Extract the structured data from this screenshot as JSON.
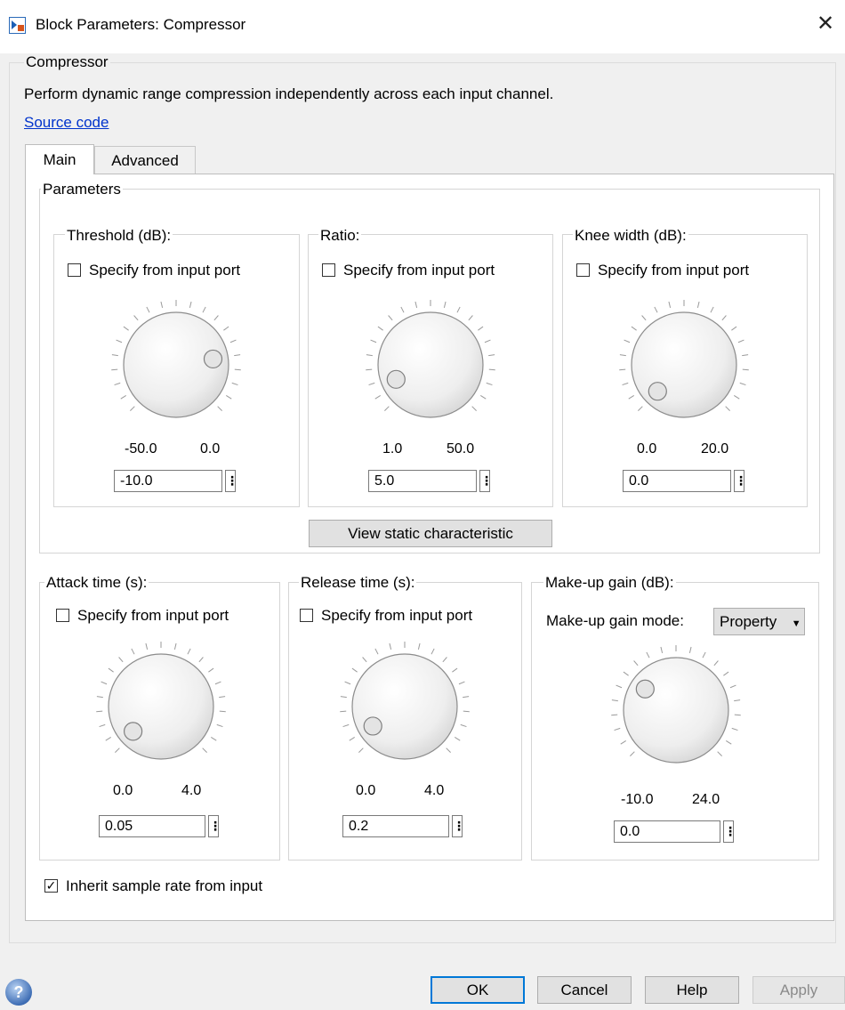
{
  "window": {
    "title": "Block Parameters: Compressor",
    "app_icon": "simulink-block-icon",
    "close_icon": "close-icon",
    "close_glyph": "✕"
  },
  "block": {
    "name": "Compressor",
    "description": "Perform dynamic range compression independently across each input channel.",
    "source_link": "Source code"
  },
  "tabs": [
    {
      "label": "Main",
      "active": true
    },
    {
      "label": "Advanced",
      "active": false
    }
  ],
  "parameters_group": "Parameters",
  "knobs": {
    "threshold": {
      "label": "Threshold (dB):",
      "port_label": "Specify from input port",
      "from_port": false,
      "min": "-50.0",
      "max": "0.0",
      "value": "-10.0",
      "fraction": 0.8
    },
    "ratio": {
      "label": "Ratio:",
      "port_label": "Specify from input port",
      "from_port": false,
      "min": "1.0",
      "max": "50.0",
      "value": "5.0",
      "fraction": 0.082
    },
    "knee": {
      "label": "Knee width (dB):",
      "port_label": "Specify from input port",
      "from_port": false,
      "min": "0.0",
      "max": "20.0",
      "value": "0.0",
      "fraction": 0.0
    },
    "attack": {
      "label": "Attack time (s):",
      "port_label": "Specify from input port",
      "from_port": false,
      "min": "0.0",
      "max": "4.0",
      "value": "0.05",
      "fraction": 0.0125
    },
    "release": {
      "label": "Release time (s):",
      "port_label": "Specify from input port",
      "from_port": false,
      "min": "0.0",
      "max": "4.0",
      "value": "0.2",
      "fraction": 0.05
    },
    "makeup": {
      "label": "Make-up gain (dB):",
      "mode_label": "Make-up gain mode:",
      "mode_value": "Property",
      "min": "-10.0",
      "max": "24.0",
      "value": "0.0",
      "fraction": 0.294
    }
  },
  "view_button": "View static characteristic",
  "inherit": {
    "label": "Inherit sample rate from input",
    "checked": true,
    "check_glyph": "✓"
  },
  "spin_glyph": "⋮",
  "dropdown_glyph": "▼",
  "buttons": {
    "ok": "OK",
    "cancel": "Cancel",
    "help": "Help",
    "apply": "Apply"
  },
  "help_icon_glyph": "?"
}
